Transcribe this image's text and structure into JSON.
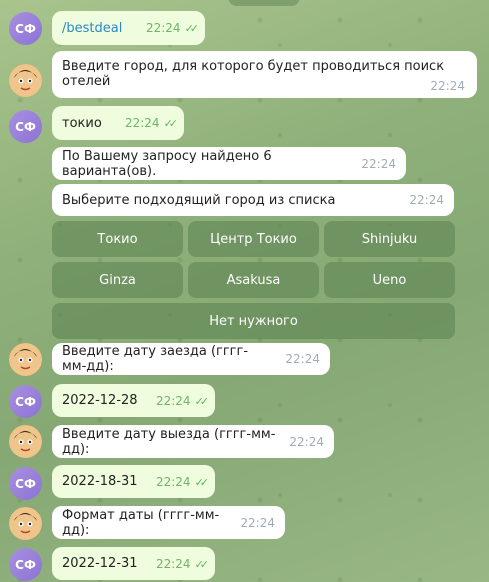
{
  "messages": [
    {
      "text": "/bestdeal",
      "time": "22:24"
    },
    {
      "text": "Введите город, для которого будет проводиться поиск отелей",
      "time": "22:24"
    },
    {
      "text": "токио",
      "time": "22:24"
    },
    {
      "text": "По Вашему запросу найдено 6 варианта(ов).",
      "time": "22:24"
    },
    {
      "text": "Выберите подходящий город из списка",
      "time": "22:24"
    },
    {
      "text": "Введите дату заезда (гггг-мм-дд):",
      "time": "22:24"
    },
    {
      "text": "2022-12-28",
      "time": "22:24"
    },
    {
      "text": "Введите дату выезда (гггг-мм-дд):",
      "time": "22:24"
    },
    {
      "text": "2022-18-31",
      "time": "22:24"
    },
    {
      "text": "Формат даты (гггг-мм-дд):",
      "time": "22:24"
    },
    {
      "text": "2022-12-31",
      "time": "22:24"
    }
  ],
  "user_avatar_initials": "СФ",
  "keyboard": [
    "Токио",
    "Центр Токио",
    "Shinjuku",
    "Ginza",
    "Asakusa",
    "Ueno",
    "Нет нужного"
  ],
  "colors": {
    "outgoing": "#effdde",
    "incoming": "#ffffff",
    "check": "#5fb35a",
    "link": "#2a87c8"
  }
}
